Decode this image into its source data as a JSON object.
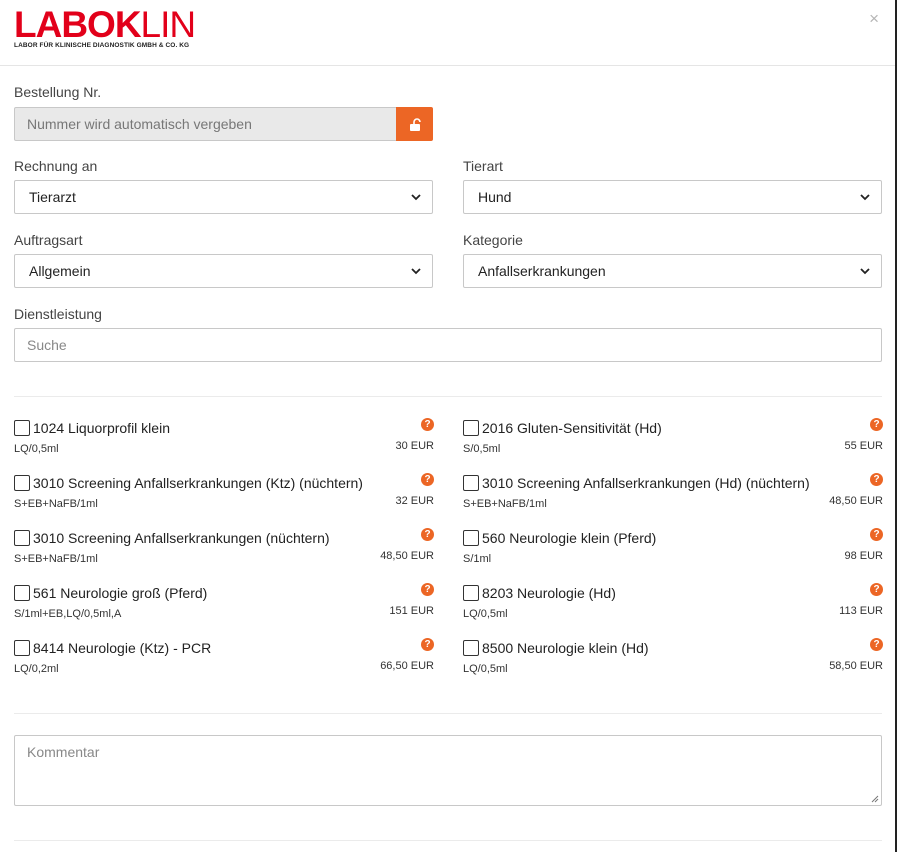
{
  "logo": {
    "main": "LABOK",
    "main_thin": "LIN",
    "subtitle": "LABOR FÜR KLINISCHE DIAGNOSTIK GMBH & CO. KG"
  },
  "close_symbol": "×",
  "order": {
    "label": "Bestellung Nr.",
    "placeholder": "Nummer wird automatisch vergeben",
    "lock_icon": "unlock-icon"
  },
  "invoice": {
    "label": "Rechnung an",
    "value": "Tierarzt"
  },
  "animal": {
    "label": "Tierart",
    "value": "Hund"
  },
  "order_type": {
    "label": "Auftragsart",
    "value": "Allgemein"
  },
  "category": {
    "label": "Kategorie",
    "value": "Anfallserkrankungen"
  },
  "service": {
    "label": "Dienstleistung",
    "placeholder": "Suche"
  },
  "services": [
    {
      "name": "1024 Liquorprofil klein",
      "sub": "LQ/0,5ml",
      "price": "30 EUR"
    },
    {
      "name": "2016 Gluten-Sensitivität (Hd)",
      "sub": "S/0,5ml",
      "price": "55 EUR"
    },
    {
      "name": "3010 Screening Anfallserkrankungen (Ktz) (nüchtern)",
      "sub": "S+EB+NaFB/1ml",
      "price": "32 EUR"
    },
    {
      "name": "3010 Screening Anfallserkrankungen (Hd) (nüchtern)",
      "sub": "S+EB+NaFB/1ml",
      "price": "48,50 EUR"
    },
    {
      "name": "3010 Screening Anfallserkrankungen (nüchtern)",
      "sub": "S+EB+NaFB/1ml",
      "price": "48,50 EUR"
    },
    {
      "name": "560 Neurologie klein (Pferd)",
      "sub": "S/1ml",
      "price": "98 EUR"
    },
    {
      "name": "561 Neurologie groß (Pferd)",
      "sub": "S/1ml+EB,LQ/0,5ml,A",
      "price": "151 EUR"
    },
    {
      "name": "8203 Neurologie (Hd)",
      "sub": "LQ/0,5ml",
      "price": "113 EUR"
    },
    {
      "name": "8414 Neurologie (Ktz) - PCR",
      "sub": "LQ/0,2ml",
      "price": "66,50 EUR"
    },
    {
      "name": "8500 Neurologie klein (Hd)",
      "sub": "LQ/0,5ml",
      "price": "58,50 EUR"
    }
  ],
  "help_symbol": "?",
  "comment": {
    "placeholder": "Kommentar"
  },
  "colors": {
    "brand": "#e2001a",
    "accent": "#ec6625"
  }
}
